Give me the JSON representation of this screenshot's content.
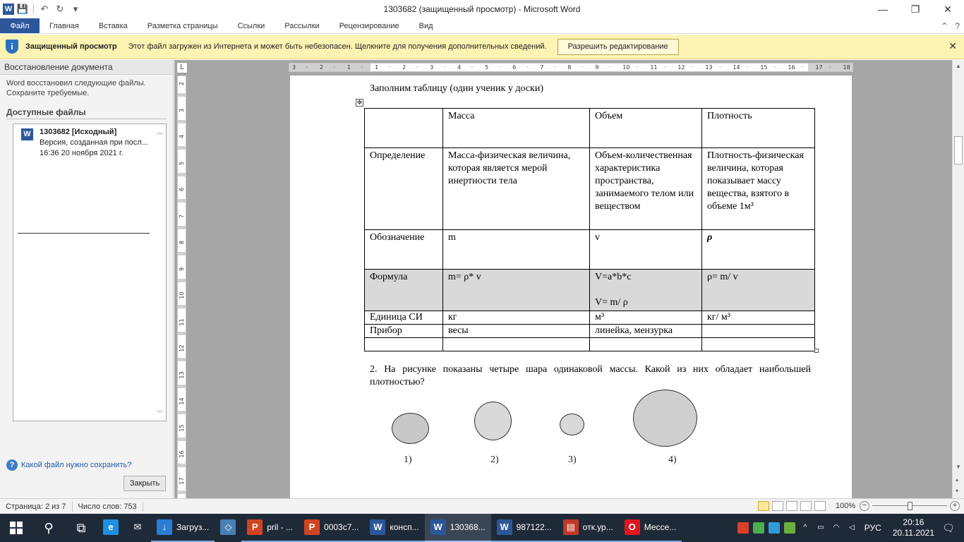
{
  "window": {
    "title": "1303682 (защищенный просмотр)  -  Microsoft Word",
    "minimize": "—",
    "maximize": "❐",
    "close": "✕"
  },
  "qat": {
    "word_logo": "W",
    "save": "💾",
    "undo": "↶",
    "redo": "↻",
    "customize": "▾"
  },
  "ribbon": {
    "file_tab": "Файл",
    "tabs": [
      "Главная",
      "Вставка",
      "Разметка страницы",
      "Ссылки",
      "Рассылки",
      "Рецензирование",
      "Вид"
    ],
    "help_icon": "?",
    "collapse_icon": "⌃"
  },
  "protected_bar": {
    "title": "Защищенный просмотр",
    "message": "Этот файл загружен из Интернета и может быть небезопасен. Щелкните для получения дополнительных сведений.",
    "button": "Разрешить редактирование",
    "close": "✕"
  },
  "recovery": {
    "header": "Восстановление документа",
    "description": "Word восстановил следующие файлы. Сохраните требуемые.",
    "available_label": "Доступные файлы",
    "file": {
      "name": "1303682  [Исходный]",
      "line1": "Версия, созданная при посл...",
      "line2": "16:36 20 ноября 2021 г."
    },
    "help_link": "Какой файл нужно сохранить?",
    "close_button": "Закрыть"
  },
  "rulers": {
    "corner": "L",
    "h_ticks": [
      "3",
      "·",
      "2",
      "·",
      "1",
      "·",
      "1",
      "·",
      "2",
      "·",
      "3",
      "·",
      "4",
      "·",
      "5",
      "·",
      "6",
      "·",
      "7",
      "·",
      "8",
      "·",
      "9",
      "·",
      "10",
      "·",
      "11",
      "·",
      "12",
      "·",
      "13",
      "·",
      "14",
      "·",
      "15",
      "·",
      "16",
      "·",
      "17",
      "·",
      "18"
    ],
    "v_ticks": [
      "2",
      "3",
      "4",
      "5",
      "6",
      "7",
      "8",
      "9",
      "10",
      "11",
      "12",
      "13",
      "14",
      "15",
      "16",
      "17"
    ]
  },
  "document": {
    "intro": "Заполним таблицу (один ученик у доски)",
    "table": {
      "header": [
        "",
        "Масса",
        "Объем",
        "Плотность"
      ],
      "rows": [
        [
          "Определение",
          "Масса-физическая величина,  которая является мерой инертности тела",
          "Объем-количественная характеристика пространства, занимаемого телом или веществом",
          "Плотность-физическая величина, которая показывает массу вещества, взятого в объеме  1м³"
        ],
        [
          "Обозначение",
          "m",
          "v",
          "ρ"
        ],
        [
          "Формула",
          "m= ρ* v",
          "V=a*b*c",
          "ρ= m/ v"
        ],
        [
          "Единица СИ",
          "кг",
          "м³",
          "кг/ м³"
        ],
        [
          "Прибор",
          "весы",
          "линейка, мензурка",
          ""
        ],
        [
          "",
          "",
          "",
          ""
        ]
      ],
      "formula_volume_alt": "V= m/ ρ"
    },
    "question2": "2.  На  рисунке  показаны  четыре  шара  одинаковой  массы.  Какой  из  них  обладает наибольшей плотностью?",
    "balls": [
      {
        "label": "1)",
        "fill": "#c8c8c8"
      },
      {
        "label": "2)",
        "fill": "#d9d9d9"
      },
      {
        "label": "3)",
        "fill": "#d9d9d9"
      },
      {
        "label": "4)",
        "fill": "#cfcfcf"
      }
    ]
  },
  "statusbar": {
    "page": "Страница: 2 из 7",
    "words": "Число слов: 753",
    "zoom": "100%",
    "zoom_minus": "−",
    "zoom_plus": "+",
    "zoom_level": 1.0
  },
  "taskbar": {
    "search_icon": "⚲",
    "taskview_icon": "⧉",
    "apps": [
      {
        "icon": "e",
        "label": "",
        "color": "#1e90e0",
        "state": "none"
      },
      {
        "icon": "✉",
        "label": "",
        "color": "#1f2a38",
        "state": "none"
      },
      {
        "icon": "↓",
        "label": "Загруз...",
        "color": "#2b7cd3",
        "state": "open"
      },
      {
        "icon": "◇",
        "label": "",
        "color": "#4a7fb5",
        "state": "none"
      },
      {
        "icon": "P",
        "label": "pril - ...",
        "color": "#d04423",
        "state": "open"
      },
      {
        "icon": "P",
        "label": "0003c7...",
        "color": "#d04423",
        "state": "open"
      },
      {
        "icon": "W",
        "label": "консп...",
        "color": "#2b579a",
        "state": "open"
      },
      {
        "icon": "W",
        "label": "130368...",
        "color": "#2b579a",
        "state": "active"
      },
      {
        "icon": "W",
        "label": "987122...",
        "color": "#2b579a",
        "state": "open"
      },
      {
        "icon": "▤",
        "label": "отк.ур...",
        "color": "#c0392b",
        "state": "open"
      },
      {
        "icon": "O",
        "label": "Мессе...",
        "color": "#e0161e",
        "state": "open"
      }
    ],
    "tray": {
      "language": "РУС",
      "time": "20:16",
      "date": "20.11.2021",
      "notifications_icon": "🗨"
    }
  }
}
